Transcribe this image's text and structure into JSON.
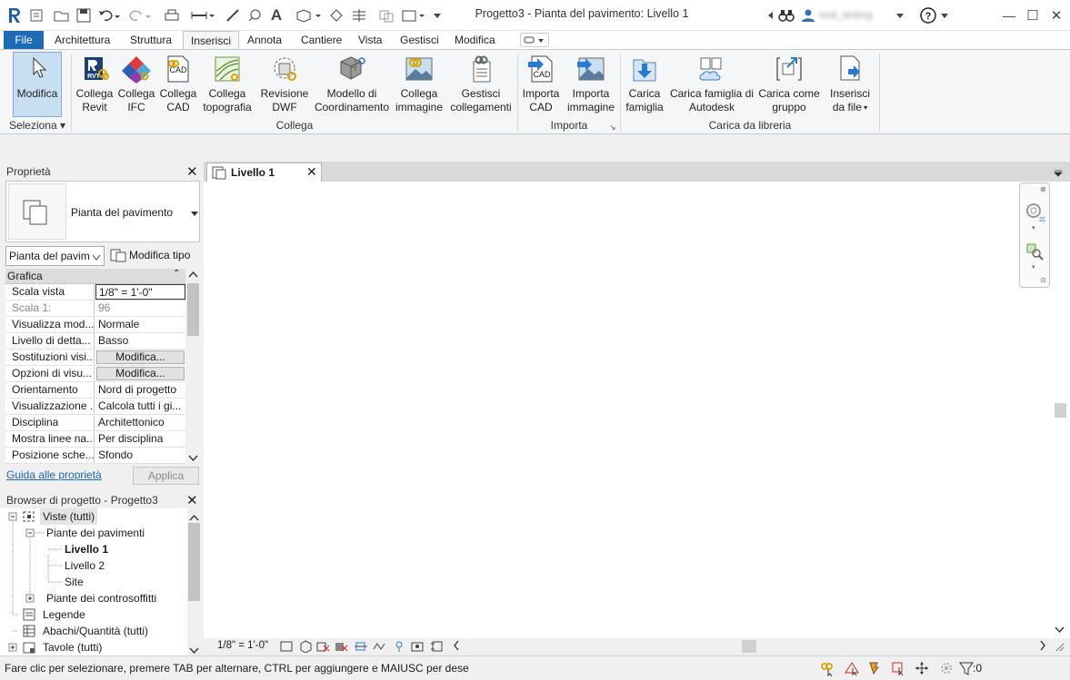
{
  "title_bar": {
    "title": "Progetto3 - Pianta del pavimento: Livello 1",
    "user": "revit_testing",
    "help_icon": "question-icon",
    "buttons": {
      "minimize": "—",
      "maximize": "☐",
      "close": "✕"
    }
  },
  "menu_tabs": [
    "File",
    "Architettura",
    "Struttura",
    "Inserisci",
    "Annota",
    "Cantiere",
    "Vista",
    "Gestisci",
    "Modifica"
  ],
  "active_tab": "Inserisci",
  "ribbon": {
    "modify": {
      "label": "Modifica"
    },
    "select_group": "Seleziona",
    "link_buttons": [
      {
        "line1": "Collega",
        "line2": "Revit",
        "icon": "link-revit-icon"
      },
      {
        "line1": "Collega",
        "line2": "IFC",
        "icon": "link-ifc-icon"
      },
      {
        "line1": "Collega",
        "line2": "CAD",
        "icon": "link-cad-icon"
      },
      {
        "line1": "Collega",
        "line2": "topografia",
        "icon": "link-topography-icon"
      },
      {
        "line1": "Revisione",
        "line2": "DWF",
        "icon": "dwf-markup-icon"
      },
      {
        "line1": "Modello di",
        "line2": "Coordinamento",
        "icon": "coordination-model-icon"
      },
      {
        "line1": "Collega",
        "line2": "immagine",
        "icon": "link-image-icon"
      },
      {
        "line1": "Gestisci",
        "line2": "collegamenti",
        "icon": "manage-links-icon"
      }
    ],
    "link_group": "Collega",
    "import_buttons": [
      {
        "line1": "Importa",
        "line2": "CAD",
        "icon": "import-cad-icon"
      },
      {
        "line1": "Importa",
        "line2": "immagine",
        "icon": "import-image-icon"
      }
    ],
    "import_group": "Importa",
    "library_buttons": [
      {
        "line1": "Carica",
        "line2": "famiglia",
        "icon": "load-family-icon"
      },
      {
        "line1": "Carica famiglia di",
        "line2": "Autodesk",
        "icon": "autodesk-family-icon"
      },
      {
        "line1": "Carica come",
        "line2": "gruppo",
        "icon": "load-group-icon"
      },
      {
        "line1": "Inserisci",
        "line2": "da file",
        "icon": "insert-from-file-icon"
      }
    ],
    "library_group": "Carica da libreria",
    "cad_tag": "CAD",
    "rvt_tag": "RVT"
  },
  "properties": {
    "title": "Proprietà",
    "type_name": "Pianta del pavimento",
    "type_selector": "Pianta del pavim",
    "edit_type": "Modifica tipo",
    "section": "Grafica",
    "rows": [
      {
        "key": "Scala vista",
        "value": "1/8\" = 1'-0\""
      },
      {
        "key": "Scala  1:",
        "value": "96"
      },
      {
        "key": "Visualizza mod...",
        "value": "Normale"
      },
      {
        "key": "Livello di detta...",
        "value": "Basso"
      },
      {
        "key": "Sostituzioni visi...",
        "value": "Modifica..."
      },
      {
        "key": "Opzioni di visu...",
        "value": "Modifica..."
      },
      {
        "key": "Orientamento",
        "value": "Nord di progetto"
      },
      {
        "key": "Visualizzazione ...",
        "value": "Calcola tutti i gi..."
      },
      {
        "key": "Disciplina",
        "value": "Architettonico"
      },
      {
        "key": "Mostra linee na...",
        "value": "Per disciplina"
      },
      {
        "key": "Posizione sche...",
        "value": "Sfondo"
      }
    ],
    "help_link": "Guida alle proprietà",
    "apply": "Applica"
  },
  "browser": {
    "title": "Browser di progetto - Progetto3",
    "views": "Viste (tutti)",
    "floor_plans": "Piante dei pavimenti",
    "level1": "Livello 1",
    "level2": "Livello 2",
    "site": "Site",
    "ceiling_plans": "Piante dei controsoffitti",
    "legends": "Legende",
    "schedules": "Abachi/Quantità (tutti)",
    "sheets": "Tavole (tutti)"
  },
  "view": {
    "tab": "Livello 1",
    "scale": "1/8\" = 1'-0\""
  },
  "status": {
    "text": "Fare clic per selezionare, premere TAB per alternare, CTRL per aggiungere e MAIUSC per dese",
    "filter_count": ":0"
  },
  "colors": {
    "file_tab": "#1e6bb8",
    "selection": "#c8dff2",
    "accent": "#2a7bd0"
  }
}
